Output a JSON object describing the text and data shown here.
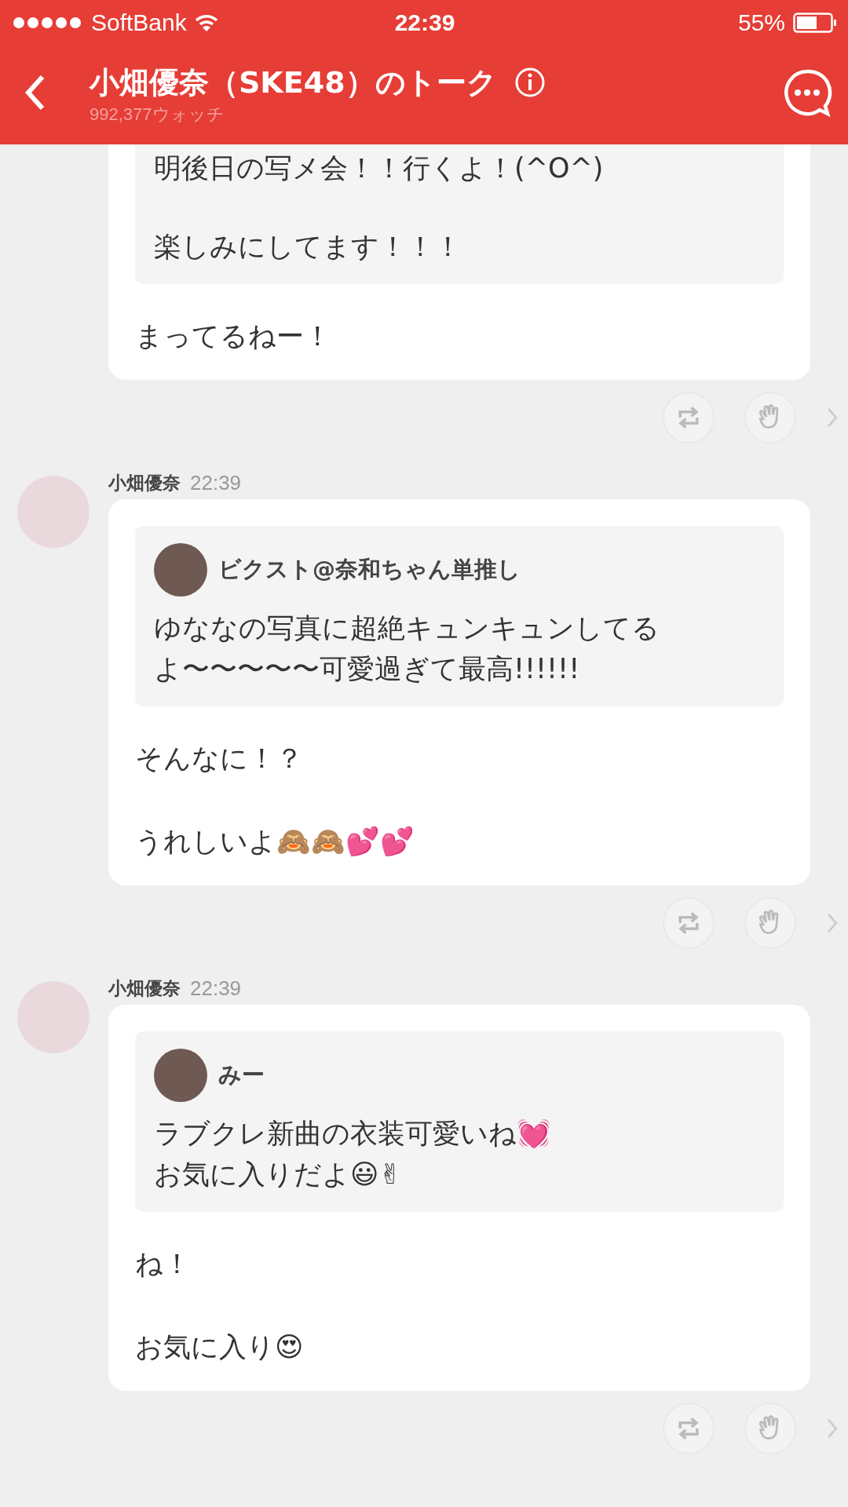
{
  "status_bar": {
    "carrier": "SoftBank",
    "time": "22:39",
    "battery": "55%"
  },
  "header": {
    "title": "小畑優奈（SKE48）のトーク",
    "subtitle": "992,377ウォッチ"
  },
  "messages": [
    {
      "quote": {
        "paragraphs": [
          {
            "lines": [
              {
                "text": "明後日の写メ会！！行くよ！(^O^)"
              }
            ]
          },
          {
            "lines": [
              {
                "text": "楽しみにしてます！！！"
              }
            ]
          }
        ]
      },
      "reply": [
        {
          "lines": [
            {
              "text": "まってるねー！"
            }
          ]
        }
      ]
    },
    {
      "sender": "小畑優奈",
      "time": "22:39",
      "quote": {
        "author": "ビクスト@奈和ちゃん単推し",
        "paragraphs": [
          {
            "lines": [
              {
                "text": "ゆななの写真に超絶キュンキュンしてる"
              },
              {
                "text": "よ〜〜〜〜〜可愛過ぎて最高!!!!!!"
              }
            ]
          }
        ]
      },
      "reply": [
        {
          "lines": [
            {
              "text": "そんなに！？"
            }
          ]
        },
        {
          "lines": [
            {
              "text": "うれしいよ🙈🙈💕💕"
            }
          ]
        }
      ]
    },
    {
      "sender": "小畑優奈",
      "time": "22:39",
      "quote": {
        "author": "みー",
        "paragraphs": [
          {
            "lines": [
              {
                "text": "ラブクレ新曲の衣装可愛いね💓"
              },
              {
                "text": "お気に入りだよ😃✌"
              }
            ]
          }
        ]
      },
      "reply": [
        {
          "lines": [
            {
              "text": "ね！"
            }
          ]
        },
        {
          "lines": [
            {
              "text": "お気に入り😍"
            }
          ]
        }
      ]
    }
  ]
}
